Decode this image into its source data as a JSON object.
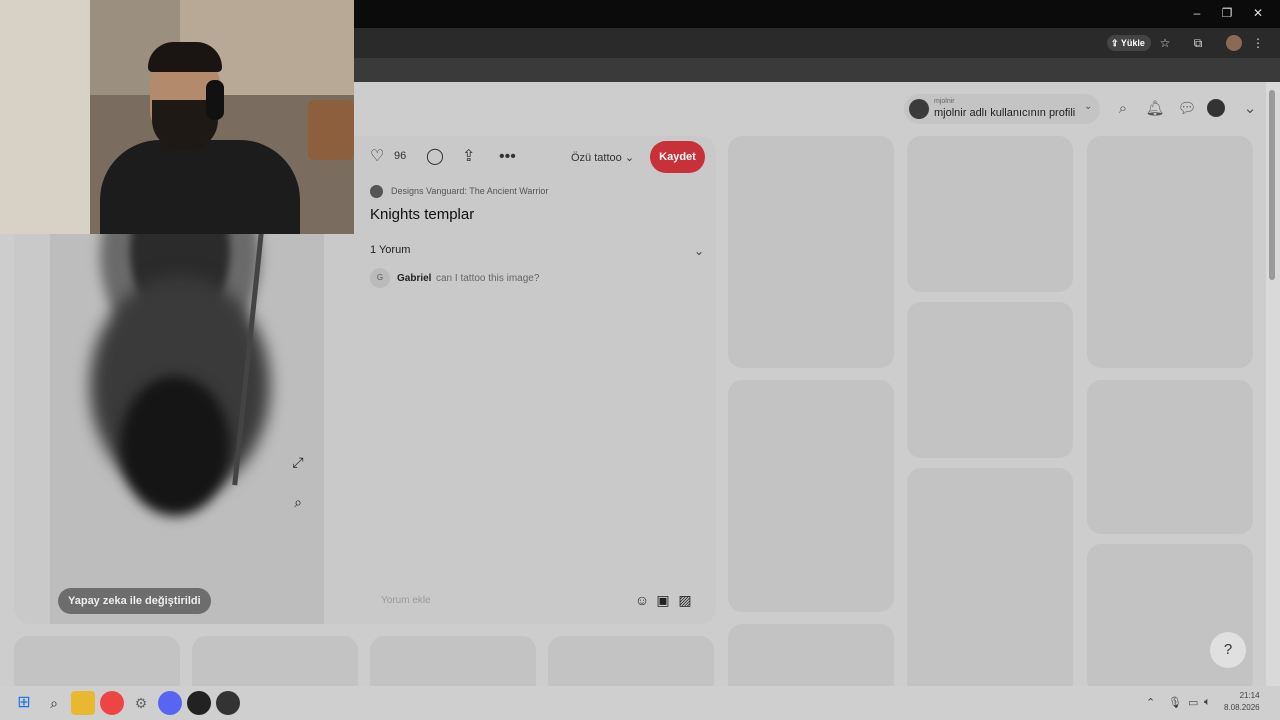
{
  "browser": {
    "window_controls": [
      "–",
      "❐",
      "✕"
    ],
    "upload_label": "Yükle"
  },
  "header": {
    "profile_small": "mjolnir",
    "profile_label": "mjolnir adlı kullanıcının profili",
    "icons": [
      "search-icon",
      "bell-icon",
      "messages-icon",
      "avatar",
      "chevron-down-icon"
    ]
  },
  "pin": {
    "like_count": "96",
    "board": "Özü tattoo",
    "save_label": "Kaydet",
    "creator": "Designs Vanguard: The Ancient Warrior",
    "title": "Knights templar",
    "ai_badge": "Yapay zeka ile değiştirildi",
    "comments_header": "1 Yorum",
    "comments": [
      {
        "initial": "G",
        "author": "Gabriel",
        "text": "can I tattoo this image?"
      }
    ],
    "comment_placeholder": "Yorum ekle"
  },
  "help_label": "?",
  "taskbar": {
    "clock_time": "21:14",
    "clock_date": "8.08.2026"
  }
}
